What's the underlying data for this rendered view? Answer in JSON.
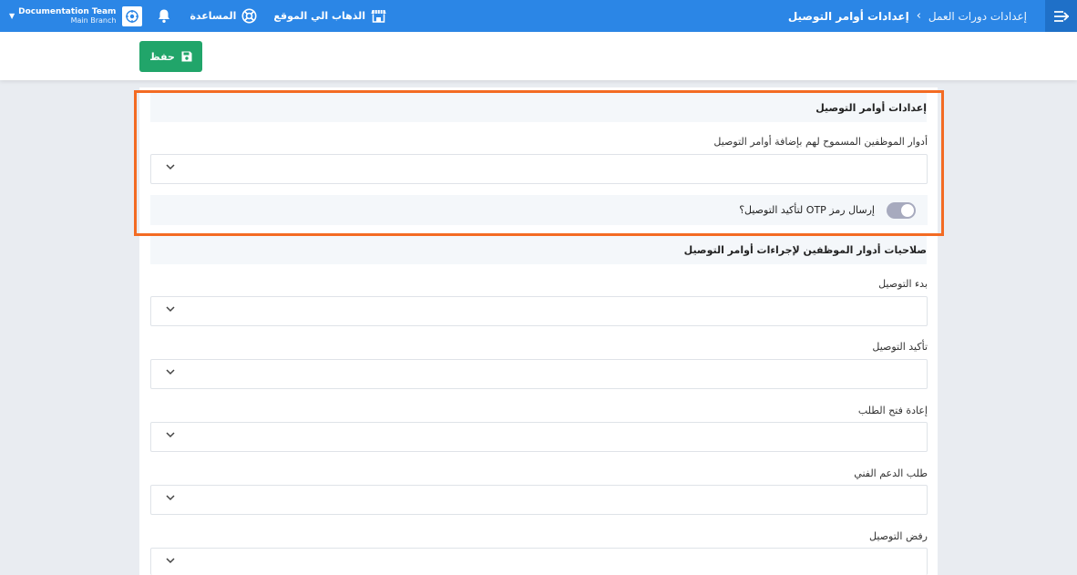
{
  "topbar": {
    "breadcrumb_parent": "إعدادات دورات العمل",
    "breadcrumb_separator": "›",
    "breadcrumb_current": "إعدادات أوامر التوصيل",
    "go_to_site": "الذهاب الي الموقع",
    "help": "المساعدة",
    "team_name": "Documentation Team",
    "branch_name": "Main Branch",
    "caret": "▼"
  },
  "toolbar": {
    "save_label": "حفظ"
  },
  "section1": {
    "title": "إعدادات أوامر التوصيل",
    "roles_label": "أدوار الموظفين المسموح لهم بإضافة أوامر التوصيل",
    "otp_label": "إرسال رمز OTP لتأكيد التوصيل؟",
    "otp_enabled": false
  },
  "section2": {
    "title": "صلاحيات أدوار الموظفين لإجراءات أوامر التوصيل",
    "fields": [
      {
        "label": "بدء التوصيل"
      },
      {
        "label": "تأكيد التوصيل"
      },
      {
        "label": "إعادة فتح الطلب"
      },
      {
        "label": "طلب الدعم الفني"
      },
      {
        "label": "رفض التوصيل"
      }
    ]
  },
  "colors": {
    "topbar": "#2b86e6",
    "save_button": "#21a56a",
    "highlight": "#f36b23"
  },
  "icons": [
    "menu-toggle-icon",
    "store-icon",
    "lifebuoy-icon",
    "bell-icon",
    "org-avatar-icon",
    "save-icon",
    "chevron-down-icon"
  ]
}
